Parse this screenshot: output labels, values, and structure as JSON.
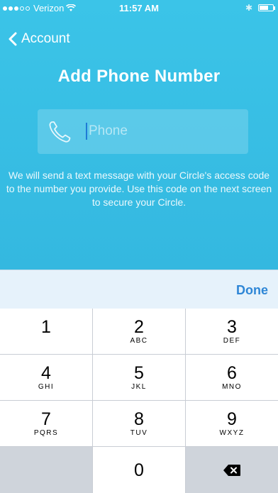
{
  "status_bar": {
    "carrier": "Verizon",
    "time": "11:57 AM"
  },
  "nav": {
    "back_label": "Account"
  },
  "title": "Add Phone Number",
  "phone_field": {
    "placeholder": "Phone",
    "value": ""
  },
  "description": "We will send a text message with your Circle's access code to the number you provide.  Use this code on the next screen to secure your Circle.",
  "keyboard": {
    "done_label": "Done",
    "keys": [
      {
        "num": "1",
        "letters": ""
      },
      {
        "num": "2",
        "letters": "ABC"
      },
      {
        "num": "3",
        "letters": "DEF"
      },
      {
        "num": "4",
        "letters": "GHI"
      },
      {
        "num": "5",
        "letters": "JKL"
      },
      {
        "num": "6",
        "letters": "MNO"
      },
      {
        "num": "7",
        "letters": "PQRS"
      },
      {
        "num": "8",
        "letters": "TUV"
      },
      {
        "num": "9",
        "letters": "WXYZ"
      },
      {
        "num": "0",
        "letters": ""
      }
    ]
  },
  "colors": {
    "background": "#3bc4e8",
    "accent": "#2e86d6",
    "caret": "#1f7ad6"
  }
}
